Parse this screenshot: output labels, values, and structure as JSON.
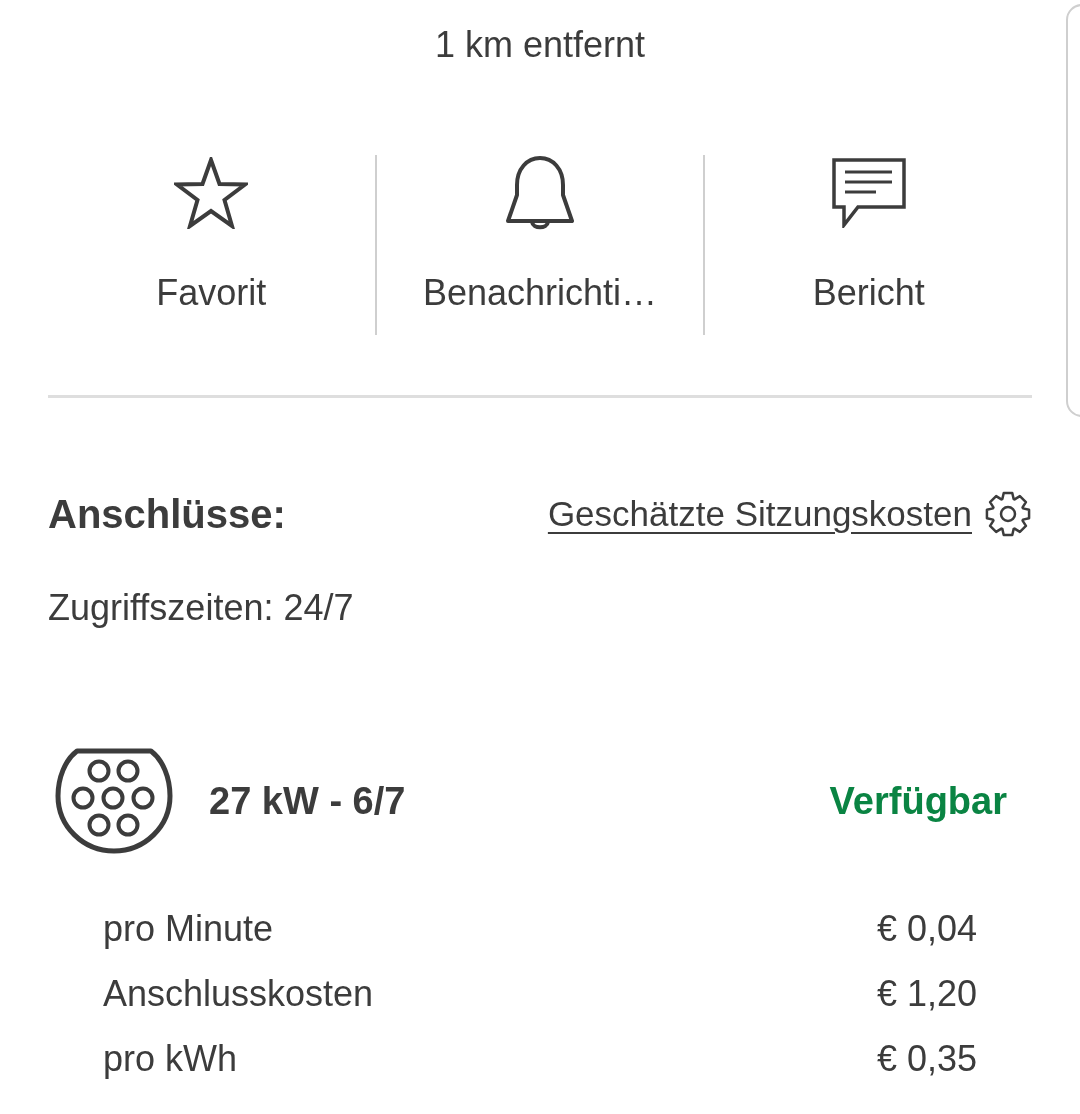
{
  "distance": "1 km entfernt",
  "actions": [
    {
      "kind": "star",
      "label": "Favorit"
    },
    {
      "kind": "bell",
      "label": "Benachrichti…"
    },
    {
      "kind": "comment",
      "label": "Bericht"
    }
  ],
  "connectors_section": {
    "title": "Anschlüsse:",
    "cost_link": "Geschätzte Sitzungskosten",
    "access_hours": "Zugriffszeiten: 24/7"
  },
  "connectors": [
    {
      "title": "27 kW - 6/7",
      "status": "Verfügbar",
      "color": "#0a8443",
      "prices": [
        {
          "label": "pro Minute",
          "value": "€ 0,04"
        },
        {
          "label": "Anschlusskosten",
          "value": "€ 1,20"
        },
        {
          "label": "pro kWh",
          "value": "€ 0,35"
        }
      ]
    }
  ]
}
